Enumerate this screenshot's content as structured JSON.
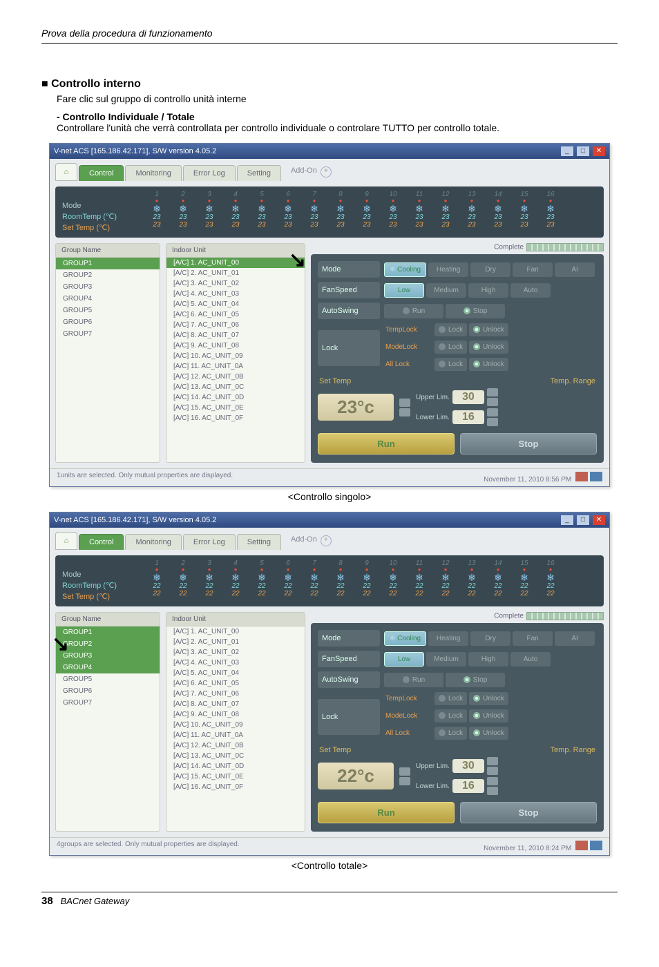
{
  "page": {
    "breadcrumb": "Prova della procedura di funzionamento",
    "footer_num": "38",
    "footer_text": "BACnet Gateway",
    "section_title": "Controllo interno",
    "section_sub": "Fare clic sul gruppo di controllo unità interne",
    "sub2_head": "- Controllo Individuale / Totale",
    "sub2_text": "Controllare l'unità che verrà controllata per controllo individuale o controlare TUTTO per controllo totale.",
    "caption1": "<Controllo singolo>",
    "caption2": "<Controllo totale>"
  },
  "win_title": "V-net ACS [165.186.42.171],   S/W version 4.05.2",
  "tabs": {
    "home": "Home",
    "control": "Control",
    "monitoring": "Monitoring",
    "errorlog": "Error Log",
    "setting": "Setting",
    "addon": "Add-On"
  },
  "status_left": {
    "mode": "Mode",
    "room": "RoomTemp (℃)",
    "set": "Set Temp   (℃)"
  },
  "group_head": "Group Name",
  "groups": [
    "GROUP1",
    "GROUP2",
    "GROUP3",
    "GROUP4",
    "GROUP5",
    "GROUP6",
    "GROUP7"
  ],
  "indoor_head": "Indoor Unit",
  "units": [
    "[A/C] 1. AC_UNIT_00",
    "[A/C] 2. AC_UNIT_01",
    "[A/C] 3. AC_UNIT_02",
    "[A/C] 4. AC_UNIT_03",
    "[A/C] 5. AC_UNIT_04",
    "[A/C] 6. AC_UNIT_05",
    "[A/C] 7. AC_UNIT_06",
    "[A/C] 8. AC_UNIT_07",
    "[A/C] 9. AC_UNIT_08",
    "[A/C] 10. AC_UNIT_09",
    "[A/C] 11. AC_UNIT_0A",
    "[A/C] 12. AC_UNIT_0B",
    "[A/C] 13. AC_UNIT_0C",
    "[A/C] 14. AC_UNIT_0D",
    "[A/C] 15. AC_UNIT_0E",
    "[A/C] 16. AC_UNIT_0F"
  ],
  "complete": "Complete",
  "ctrl": {
    "mode": "Mode",
    "cooling": "Cooling",
    "heating": "Heating",
    "dry": "Dry",
    "fan": "Fan",
    "ai": "AI",
    "fanspeed": "FanSpeed",
    "low": "Low",
    "medium": "Medium",
    "high": "High",
    "auto": "Auto",
    "autoswing": "AutoSwing",
    "run": "Run",
    "stop": "Stop",
    "lock": "Lock",
    "templock": "TempLock",
    "modelock": "ModeLock",
    "alllock": "All Lock",
    "lockw": "Lock",
    "unlock": "Unlock",
    "settemp": "Set Temp",
    "temprange": "Temp. Range",
    "upper": "Upper Lim.",
    "lower": "Lower Lim."
  },
  "app1": {
    "temp": "23",
    "settemp": "23°c",
    "upper": "30",
    "lower": "16",
    "status_msg": "1units are selected. Only mutual properties are displayed.",
    "timestamp": "November 11, 2010  8:56 PM"
  },
  "app2": {
    "temp": "22",
    "settemp": "22°c",
    "upper": "30",
    "lower": "16",
    "status_msg": "4groups are selected. Only mutual properties are displayed.",
    "timestamp": "November 11, 2010  8:24 PM"
  }
}
